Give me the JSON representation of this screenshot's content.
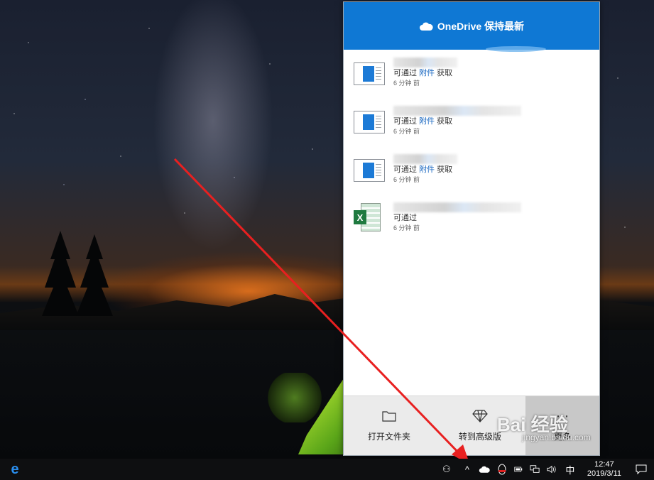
{
  "flyout": {
    "header_title": "OneDrive 保持最新",
    "files": [
      {
        "type": "doc",
        "desc_prefix": "可通过",
        "desc_link": "附件",
        "desc_suffix": "获取",
        "time": "6 分钟 前",
        "name_blur_width": 90
      },
      {
        "type": "doc",
        "desc_prefix": "可通过",
        "desc_link": "附件",
        "desc_suffix": "获取",
        "time": "6 分钟 前",
        "name_blur_width": 180
      },
      {
        "type": "doc",
        "desc_prefix": "可通过",
        "desc_link": "附件",
        "desc_suffix": "获取",
        "time": "6 分钟 前",
        "name_blur_width": 90
      },
      {
        "type": "xls",
        "desc_prefix": "可通过",
        "desc_link": "",
        "desc_suffix": "",
        "time": "6 分钟 前",
        "name_blur_width": 180
      }
    ],
    "footer": {
      "open_folder": "打开文件夹",
      "upgrade": "转到高级版",
      "more": "更多"
    }
  },
  "watermark": {
    "text": "Bai 经验",
    "url": "jingyan.baidu.com"
  },
  "taskbar": {
    "edge_glyph": "e",
    "people_glyph": "⚇",
    "chevron_glyph": "^",
    "ime": "中",
    "time": "12:47",
    "date": "2019/3/11"
  },
  "colors": {
    "accent": "#0f78d4",
    "arrow": "#e82020",
    "link": "#1565c0"
  }
}
